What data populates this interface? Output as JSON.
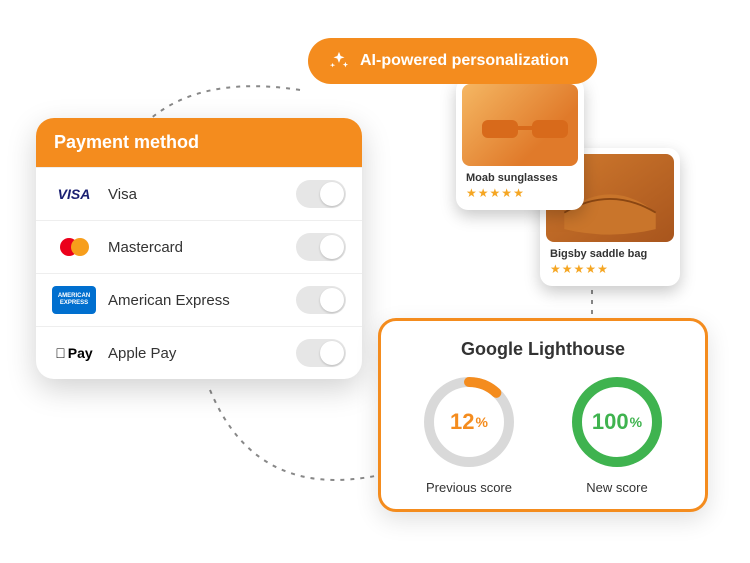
{
  "colors": {
    "accent": "#f48c1e",
    "success": "#3fb34f"
  },
  "ai_pill": {
    "label": "AI-powered personalization"
  },
  "payment": {
    "title": "Payment method",
    "methods": [
      {
        "key": "visa",
        "name": "Visa",
        "on": true
      },
      {
        "key": "mastercard",
        "name": "Mastercard",
        "on": true
      },
      {
        "key": "amex",
        "name": "American Express",
        "on": true
      },
      {
        "key": "applepay",
        "name": "Apple Pay",
        "on": true
      }
    ]
  },
  "products": [
    {
      "name": "Moab sunglasses",
      "rating": 5
    },
    {
      "name": "Bigsby saddle bag",
      "rating": 5
    }
  ],
  "lighthouse": {
    "title": "Google Lighthouse",
    "previous": {
      "value": 12,
      "label": "Previous score"
    },
    "new": {
      "value": 100,
      "label": "New score"
    }
  },
  "chart_data": [
    {
      "type": "pie",
      "title": "Previous score",
      "values": [
        12,
        88
      ],
      "categories": [
        "score",
        "remaining"
      ],
      "colors": [
        "#f48c1e",
        "#d9d9d9"
      ]
    },
    {
      "type": "pie",
      "title": "New score",
      "values": [
        100,
        0
      ],
      "categories": [
        "score",
        "remaining"
      ],
      "colors": [
        "#3fb34f",
        "#d9d9d9"
      ]
    }
  ]
}
